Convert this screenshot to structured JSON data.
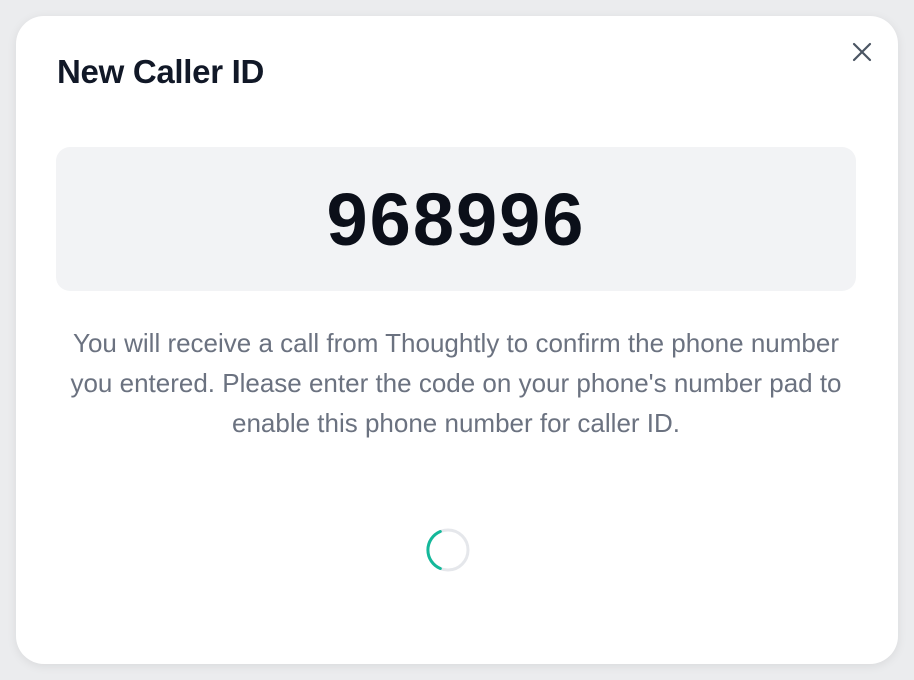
{
  "dialog": {
    "title": "New Caller ID",
    "close_icon": "close-icon",
    "verification_code": "968996",
    "description": "You will receive a call from Thoughtly to confirm the phone number you entered. Please enter the code on your phone's number pad to enable this phone number for caller ID.",
    "spinner_icon": "loading-spinner-icon"
  },
  "colors": {
    "title": "#111827",
    "code_background": "#f2f3f5",
    "description": "#6b7280",
    "spinner_accent": "#14b89a",
    "spinner_track": "#e5e7eb"
  }
}
